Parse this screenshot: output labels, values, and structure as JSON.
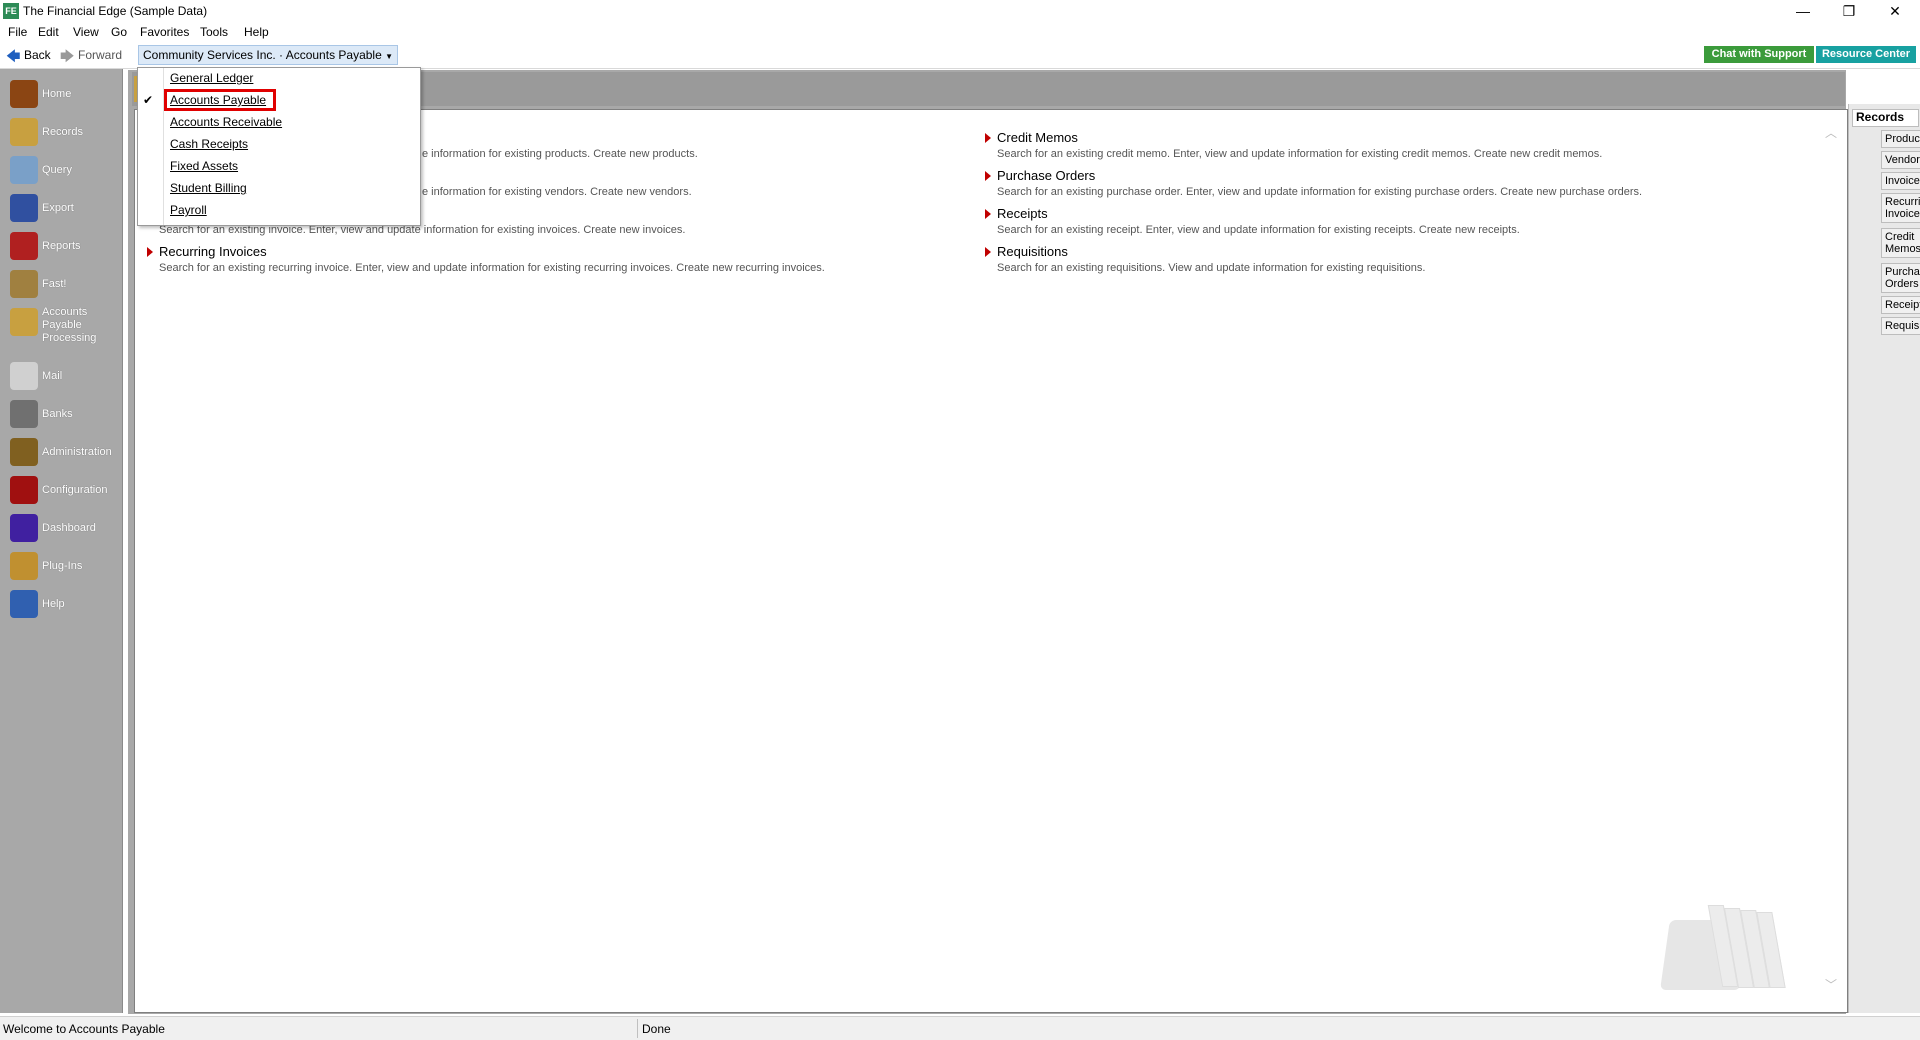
{
  "titlebar": {
    "icon_text": "FE",
    "title": "The Financial Edge (Sample Data)",
    "minimize": "—",
    "restore": "❐",
    "close": "✕"
  },
  "menubar": [
    "File",
    "Edit",
    "View",
    "Go",
    "Favorites",
    "Tools",
    "Help"
  ],
  "nav": {
    "back": "Back",
    "forward": "Forward",
    "context": "Community Services Inc. · Accounts Payable",
    "chat": "Chat with Support",
    "resource": "Resource Center"
  },
  "colors": {
    "chat_btn": "#3b9b3b",
    "resource_btn": "#18a1a1",
    "arrow": "#c00000",
    "highlight": "#e00000"
  },
  "leftnav": [
    {
      "label": "Home",
      "icon": "home-icon",
      "color": "#8b4513"
    },
    {
      "label": "Records",
      "icon": "records-icon",
      "color": "#c8a040"
    },
    {
      "label": "Query",
      "icon": "query-icon",
      "color": "#7aa0c8"
    },
    {
      "label": "Export",
      "icon": "export-icon",
      "color": "#3050a0"
    },
    {
      "label": "Reports",
      "icon": "reports-icon",
      "color": "#b02020"
    },
    {
      "label": "Fast!",
      "icon": "fast-icon",
      "color": "#a08040"
    },
    {
      "label": "Accounts Payable Processing",
      "icon": "ap-processing-icon",
      "color": "#c8a040"
    },
    {
      "label": "Mail",
      "icon": "mail-icon",
      "color": "#d0d0d0"
    },
    {
      "label": "Banks",
      "icon": "banks-icon",
      "color": "#707070"
    },
    {
      "label": "Administration",
      "icon": "administration-icon",
      "color": "#806020"
    },
    {
      "label": "Configuration",
      "icon": "configuration-icon",
      "color": "#a01010"
    },
    {
      "label": "Dashboard",
      "icon": "dashboard-icon",
      "color": "#4020a0"
    },
    {
      "label": "Plug-Ins",
      "icon": "plugins-icon",
      "color": "#c09030"
    },
    {
      "label": "Help",
      "icon": "help-icon",
      "color": "#3060b0"
    }
  ],
  "dropdown": {
    "items": [
      {
        "label": "General Ledger",
        "checked": false
      },
      {
        "label": "Accounts Payable",
        "checked": true
      },
      {
        "label": "Accounts Receivable",
        "checked": false
      },
      {
        "label": "Cash Receipts",
        "checked": false
      },
      {
        "label": "Fixed Assets",
        "checked": false
      },
      {
        "label": "Student Billing",
        "checked": false
      },
      {
        "label": "Payroll",
        "checked": false
      }
    ],
    "checkmark": "✔"
  },
  "content": {
    "left": [
      {
        "title": "",
        "desc": "e information for existing products. Create new products."
      },
      {
        "title": "",
        "desc": "e information for existing vendors. Create new vendors."
      },
      {
        "title": "",
        "desc": "Search for an existing invoice. Enter, view and update information for existing invoices. Create new invoices."
      },
      {
        "title": "Recurring Invoices",
        "desc": "Search for an existing recurring invoice. Enter, view and update information for existing recurring invoices. Create new recurring invoices."
      }
    ],
    "right": [
      {
        "title": "Credit Memos",
        "desc": "Search for an existing credit memo. Enter, view and update information for existing credit memos. Create new credit memos."
      },
      {
        "title": "Purchase Orders",
        "desc": "Search for an existing purchase order. Enter, view and update information for existing purchase orders. Create new purchase orders."
      },
      {
        "title": "Receipts",
        "desc": "Search for an existing receipt. Enter, view and update information for existing receipts. Create new receipts."
      },
      {
        "title": "Requisitions",
        "desc": "Search for an existing requisitions. View and update information for existing requisitions."
      }
    ]
  },
  "rightpanel": {
    "heading": "Records",
    "items": [
      "Products",
      "Vendors",
      "Invoices",
      "Recurring Invoices",
      "Credit Memos",
      "Purchase Orders",
      "Receipts",
      "Requisitions"
    ]
  },
  "status": {
    "left": "Welcome to Accounts Payable",
    "right": "Done"
  }
}
